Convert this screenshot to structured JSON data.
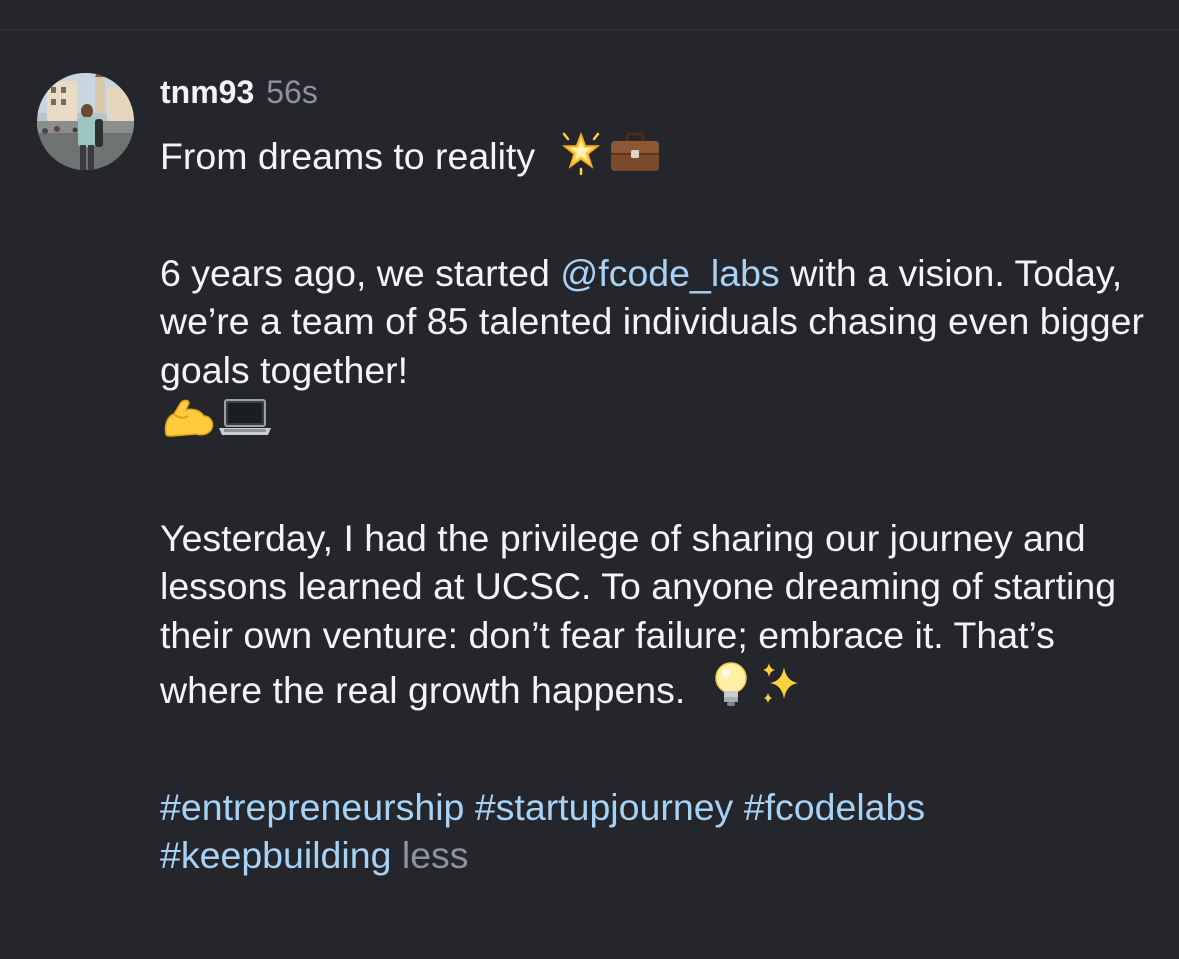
{
  "post": {
    "username": "tnm93",
    "timestamp": "56s",
    "line1": "From dreams to reality",
    "para2_part1": "6 years ago, we started ",
    "mention": "@fcode_labs",
    "para2_part2": " with a vision. Today, we’re a team of 85 talented individuals chasing even bigger goals together!",
    "para3": "Yesterday, I had the privilege of sharing our journey and lessons learned at UCSC. To anyone dreaming of starting their own venture: don’t fear failure; embrace it. That’s where the real growth happens.",
    "hashtags": [
      "#entrepreneurship",
      "#startupjourney",
      "#fcodelabs",
      "#keepbuilding"
    ],
    "less_label": "less"
  },
  "icons": {
    "avatar": "profile-photo",
    "line1_emojis": [
      "glowing-star-icon",
      "briefcase-icon"
    ],
    "para2_emojis": [
      "flexed-biceps-icon",
      "laptop-icon"
    ],
    "para3_emojis": [
      "light-bulb-icon",
      "sparkles-icon"
    ]
  },
  "colors": {
    "background": "#24262b",
    "text": "#f4f4f5",
    "muted": "#8f9298",
    "link": "#a8d2f5"
  }
}
